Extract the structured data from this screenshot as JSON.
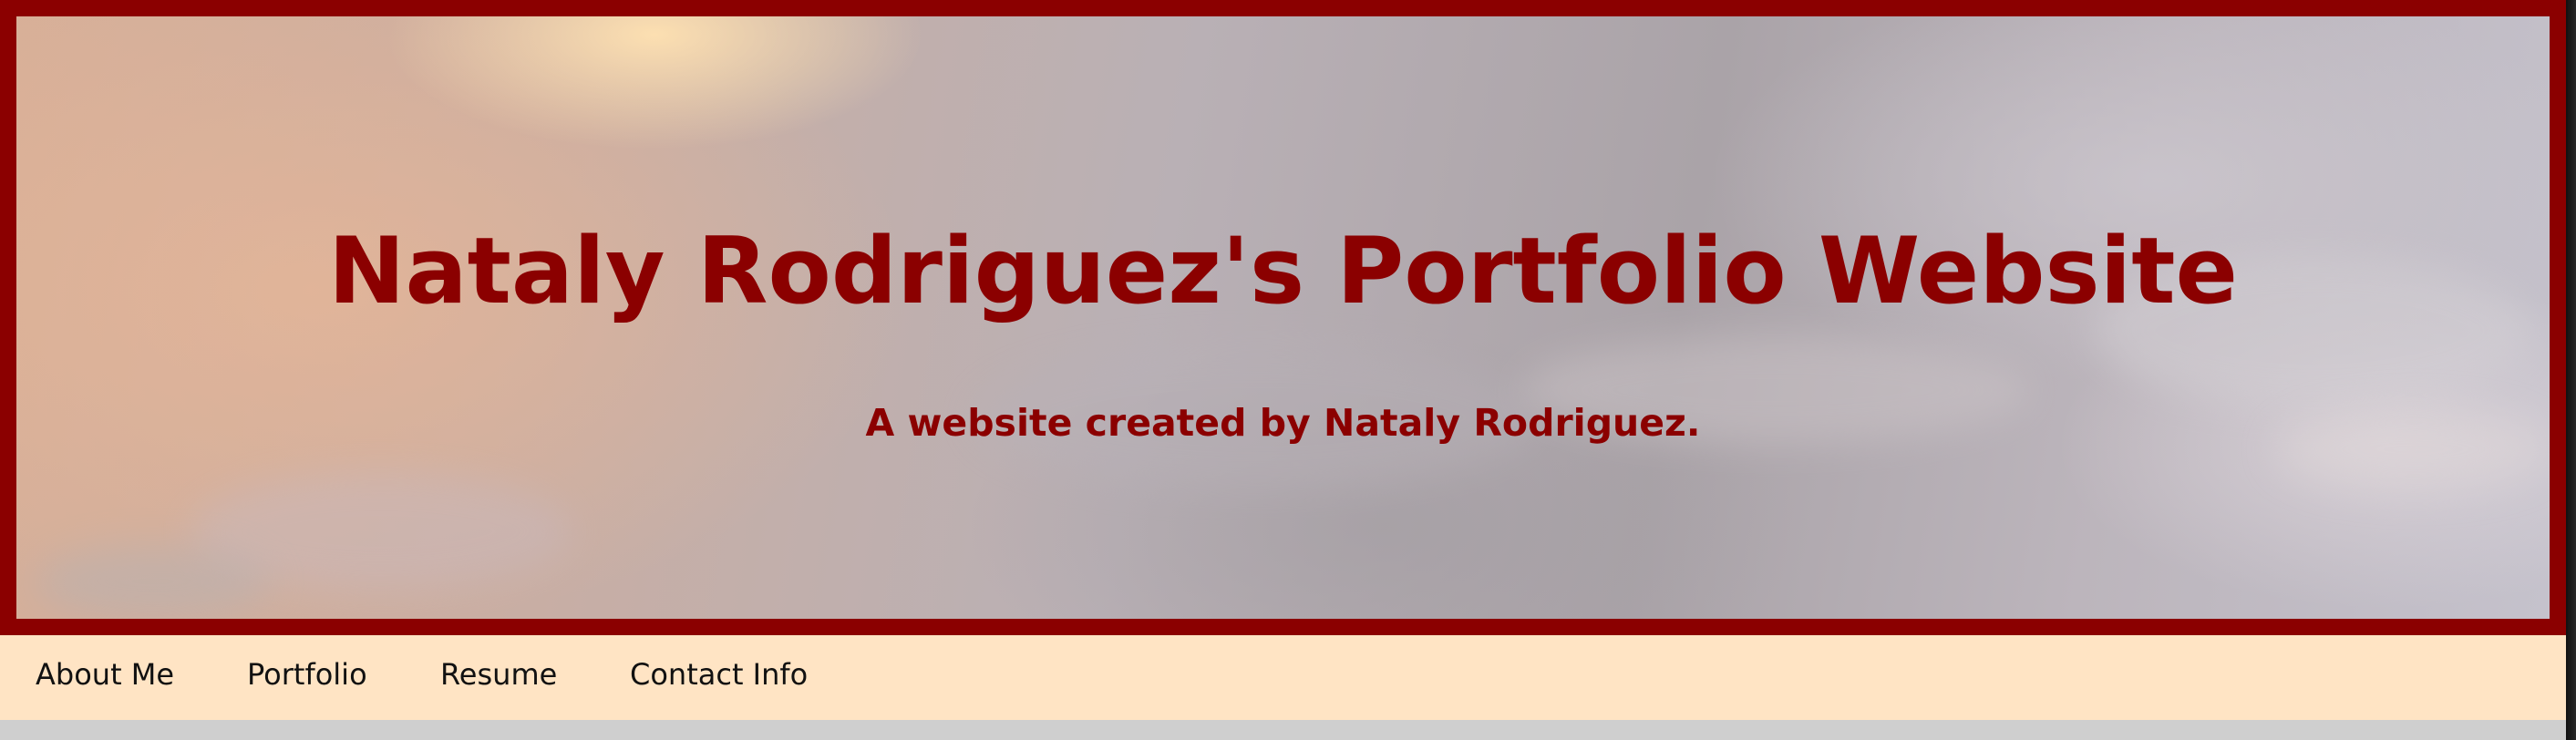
{
  "header": {
    "title": "Nataly Rodriguez's Portfolio Website",
    "subtitle": "A website created by Nataly Rodriguez."
  },
  "nav": {
    "items": [
      {
        "label": "About Me"
      },
      {
        "label": "Portfolio"
      },
      {
        "label": "Resume"
      },
      {
        "label": "Contact Info"
      }
    ]
  },
  "colors": {
    "accent": "#8b0000",
    "nav_background": "#ffe4c4",
    "page_background": "#cfcfcf"
  }
}
